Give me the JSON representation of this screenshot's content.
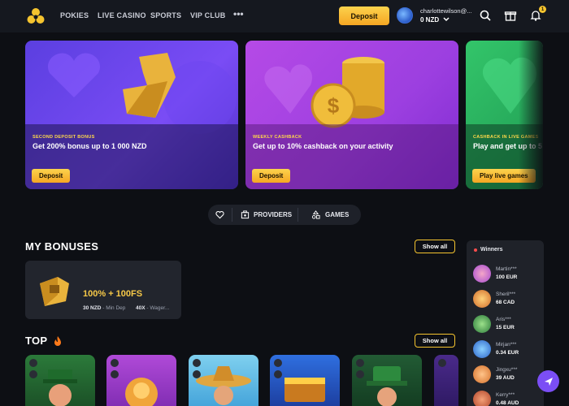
{
  "nav": {
    "items": [
      "POKIES",
      "LIVE CASINO",
      "SPORTS",
      "VIP CLUB"
    ],
    "more": "•••",
    "deposit_label": "Deposit",
    "user_email": "charlottewilson@...",
    "balance": "0 NZD",
    "notification_count": "1"
  },
  "banners": [
    {
      "eyebrow": "SECOND DEPOSIT BONUS",
      "title": "Get 200% bonus up to 1 000 NZD",
      "button": "Deposit"
    },
    {
      "eyebrow": "WEEKLY CASHBACK",
      "title": "Get up to 10% cashback on your activity",
      "button": "Deposit"
    },
    {
      "eyebrow": "CASHBACK IN LIVE GAMES",
      "title": "Play and get up to 5",
      "button": "Play live games"
    }
  ],
  "filters": {
    "providers": "PROVIDERS",
    "games": "GAMES"
  },
  "bonuses": {
    "title": "MY BONUSES",
    "show_all": "Show all",
    "card": {
      "title": "100% + 100FS",
      "min_dep_value": "30 NZD",
      "min_dep_label": "- Min Dep",
      "wager_value": "40X",
      "wager_label": "- Wager..."
    }
  },
  "top": {
    "title": "TOP",
    "show_all": "Show all"
  },
  "winners": {
    "title": "Winners",
    "rows": [
      {
        "name": "Martin***",
        "amount": "100 EUR"
      },
      {
        "name": "Sheril***",
        "amount": "68 CAD"
      },
      {
        "name": "Aris***",
        "amount": "15 EUR"
      },
      {
        "name": "Mirjan***",
        "amount": "0.34 EUR"
      },
      {
        "name": "Jingxu***",
        "amount": "39 AUD"
      },
      {
        "name": "Kerry***",
        "amount": "0.48 AUD"
      }
    ]
  },
  "colors": {
    "accent": "#f5c42f",
    "background": "#0d0f14",
    "panel": "#1f2229"
  }
}
